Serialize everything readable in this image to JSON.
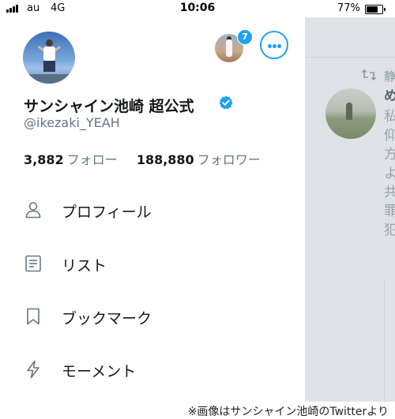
{
  "status_bar": {
    "carrier": "au",
    "network": "4G",
    "time": "10:06",
    "battery_percent": "77%",
    "battery_level": 0.77
  },
  "profile": {
    "display_name": "サンシャイン池崎 超公式",
    "handle": "@ikezaki_YEAH",
    "following_count": "3,882",
    "following_label": "フォロー",
    "followers_count": "188,880",
    "followers_label": "フォロワー",
    "account_badge_count": "7"
  },
  "menu": {
    "items": [
      {
        "label": "プロフィール",
        "icon": "person-icon"
      },
      {
        "label": "リスト",
        "icon": "list-icon"
      },
      {
        "label": "ブックマーク",
        "icon": "bookmark-icon"
      },
      {
        "label": "モーメント",
        "icon": "lightning-icon"
      }
    ]
  },
  "timeline_peek": {
    "retweet_text": "静",
    "lines": [
      "め",
      "私",
      "仰",
      "方",
      "よ",
      "共",
      "罪",
      "犯"
    ]
  },
  "caption": "※画像はサンシャイン池崎のTwitterより",
  "colors": {
    "accent": "#1da1f2",
    "text_primary": "#14171a",
    "text_secondary": "#657786",
    "overlay": "#dfe3e8"
  }
}
